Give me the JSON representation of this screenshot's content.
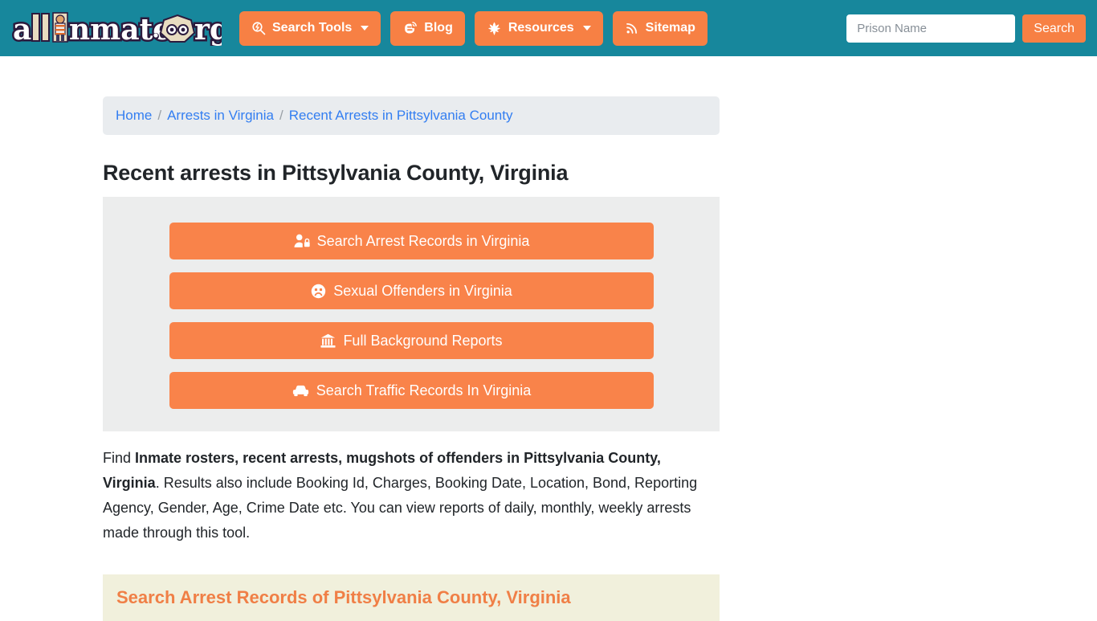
{
  "site": {
    "logo_text": "allInmates.org",
    "logo_parts": {
      "a": "a",
      "ll": "ll",
      "i_char": "I",
      "nmates": "nmates",
      "dot": ".",
      "org": "org"
    }
  },
  "header": {
    "nav": [
      {
        "label": "Search Tools",
        "icon": "search-bolt-icon",
        "has_caret": true
      },
      {
        "label": "Blog",
        "icon": "blogger-icon",
        "has_caret": false
      },
      {
        "label": "Resources",
        "icon": "leaf-icon",
        "has_caret": true
      },
      {
        "label": "Sitemap",
        "icon": "rss-icon",
        "has_caret": false
      }
    ],
    "search": {
      "placeholder": "Prison Name",
      "value": "",
      "button_label": "Search"
    },
    "background_color": "#17879c",
    "accent_color": "#f78044"
  },
  "breadcrumb": {
    "items": [
      {
        "label": "Home"
      },
      {
        "label": "Arrests in Virginia"
      },
      {
        "label": "Recent Arrests in Pittsylvania County"
      }
    ],
    "separator": "/",
    "link_color": "#337ef1",
    "background_color": "#e9ecef"
  },
  "main": {
    "page_title": "Recent arrests in Pittsylvania County, Virginia",
    "cta_buttons": [
      {
        "label": "Search Arrest Records in Virginia",
        "icon": "user-lock-icon"
      },
      {
        "label": "Sexual Offenders in Virginia",
        "icon": "frown-face-icon"
      },
      {
        "label": "Full Background Reports",
        "icon": "courthouse-icon"
      },
      {
        "label": "Search Traffic Records In Virginia",
        "icon": "car-icon"
      }
    ],
    "intro": {
      "lead": "Find ",
      "bold": "Inmate rosters, recent arrests, mugshots of offenders in Pittsylvania County, Virginia",
      "rest": ". Results also include Booking Id, Charges, Booking Date, Location, Bond, Reporting Agency, Gender, Age, Crime Date etc. You can view reports of daily, monthly, weekly arrests made through this tool."
    },
    "section_heading": "Search Arrest Records of Pittsylvania County, Virginia",
    "section_heading_bg": "#f1f0dc",
    "section_heading_color": "#f07f46"
  }
}
